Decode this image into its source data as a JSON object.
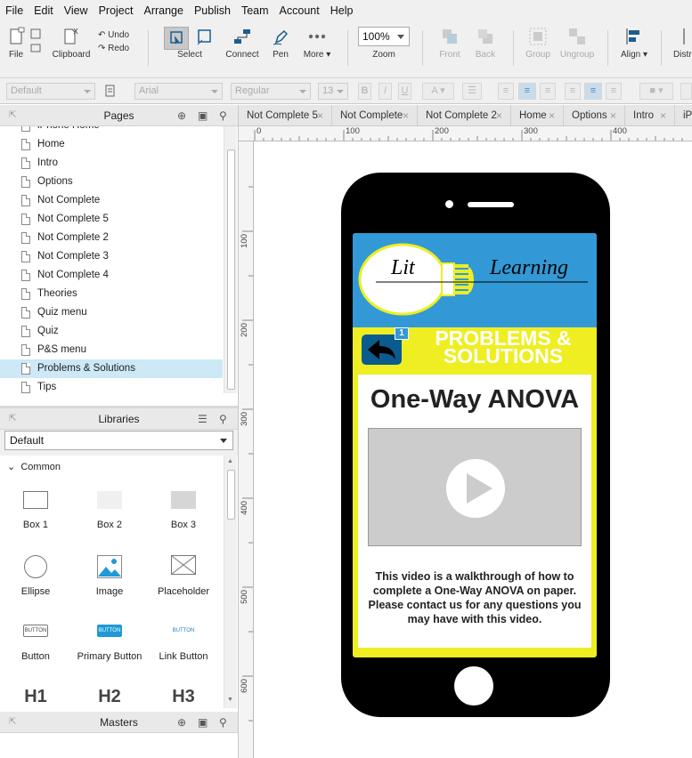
{
  "menu": [
    "File",
    "Edit",
    "View",
    "Project",
    "Arrange",
    "Publish",
    "Team",
    "Account",
    "Help"
  ],
  "toolbar": {
    "file": "File",
    "clipboard": "Clipboard",
    "undo": "Undo",
    "redo": "Redo",
    "select": "Select",
    "connect": "Connect",
    "pen": "Pen",
    "more": "More ▾",
    "zoom_value": "100%",
    "zoom_label": "Zoom",
    "front": "Front",
    "back": "Back",
    "group": "Group",
    "ungroup": "Ungroup",
    "align": "Align ▾",
    "distribute": "Distri"
  },
  "formatbar": {
    "style": "Default",
    "font": "Arial",
    "weight": "Regular",
    "size": "13"
  },
  "pages_panel": {
    "title": "Pages",
    "items": [
      "iPhone Home",
      "Home",
      "Intro",
      "Options",
      "Not Complete",
      "Not Complete 5",
      "Not Complete 2",
      "Not Complete 3",
      "Not Complete 4",
      "Theories",
      "Quiz menu",
      "Quiz",
      "P&S menu",
      "Problems & Solutions",
      "Tips"
    ],
    "selected": "Problems & Solutions"
  },
  "libraries_panel": {
    "title": "Libraries",
    "library": "Default",
    "section": "Common",
    "widgets": [
      "Box 1",
      "Box 2",
      "Box 3",
      "Ellipse",
      "Image",
      "Placeholder",
      "Button",
      "Primary Button",
      "Link Button",
      "H1",
      "H2",
      "H3"
    ],
    "button_text": "BUTTON"
  },
  "masters_panel": {
    "title": "Masters"
  },
  "tabs": [
    "Not Complete 5",
    "Not Complete",
    "Not Complete 2",
    "Home",
    "Options",
    "Intro",
    "iPh"
  ],
  "ruler": {
    "h": [
      "0",
      "100",
      "200",
      "300",
      "400"
    ],
    "v": [
      "100",
      "200",
      "300",
      "400",
      "500",
      "600"
    ]
  },
  "phone": {
    "logo_left": "Lit",
    "logo_right": "Learning",
    "badge": "1",
    "banner_line1": "PROBLEMS &",
    "banner_line2": "SOLUTIONS",
    "heading": "One-Way ANOVA",
    "description": "This video is a walkthrough of how to complete a One-Way ANOVA on paper. Please contact us for any questions you may have with this video.",
    "colors": {
      "header": "#3399d6",
      "banner": "#eeee22",
      "body": "#000000",
      "accent": "#0b5b8e"
    }
  }
}
